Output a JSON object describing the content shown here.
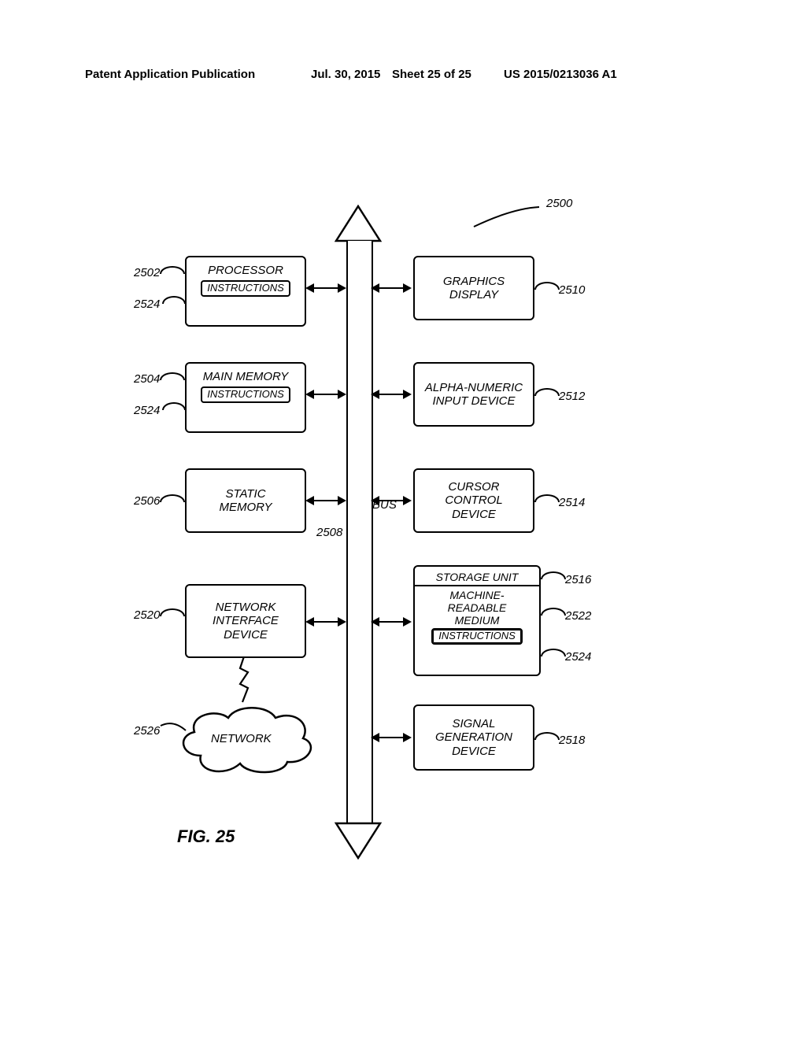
{
  "header": {
    "left": "Patent Application Publication",
    "date": "Jul. 30, 2015",
    "sheet": "Sheet 25 of 25",
    "pubno": "US 2015/0213036 A1"
  },
  "figure_label": "FIG. 25",
  "bus_label": "BUS",
  "refs": {
    "overall": "2500",
    "processor": "2502",
    "main_memory": "2504",
    "static_memory": "2506",
    "bus": "2508",
    "graphics_display": "2510",
    "input_device": "2512",
    "cursor_control": "2514",
    "storage_unit": "2516",
    "signal_gen": "2518",
    "network_iface": "2520",
    "mrm": "2522",
    "instructions_a": "2524",
    "instructions_b": "2524",
    "instructions_c": "2524",
    "network": "2526"
  },
  "labels": {
    "processor": "PROCESSOR",
    "instructions": "INSTRUCTIONS",
    "main_memory": "MAIN MEMORY",
    "static_memory": "STATIC\nMEMORY",
    "network_iface": "NETWORK\nINTERFACE\nDEVICE",
    "network": "NETWORK",
    "graphics_display": "GRAPHICS\nDISPLAY",
    "input_device": "ALPHA-NUMERIC\nINPUT DEVICE",
    "cursor_control": "CURSOR\nCONTROL\nDEVICE",
    "storage_unit": "STORAGE UNIT",
    "mrm": "MACHINE-\nREADABLE\nMEDIUM",
    "signal_gen": "SIGNAL\nGENERATION\nDEVICE"
  }
}
